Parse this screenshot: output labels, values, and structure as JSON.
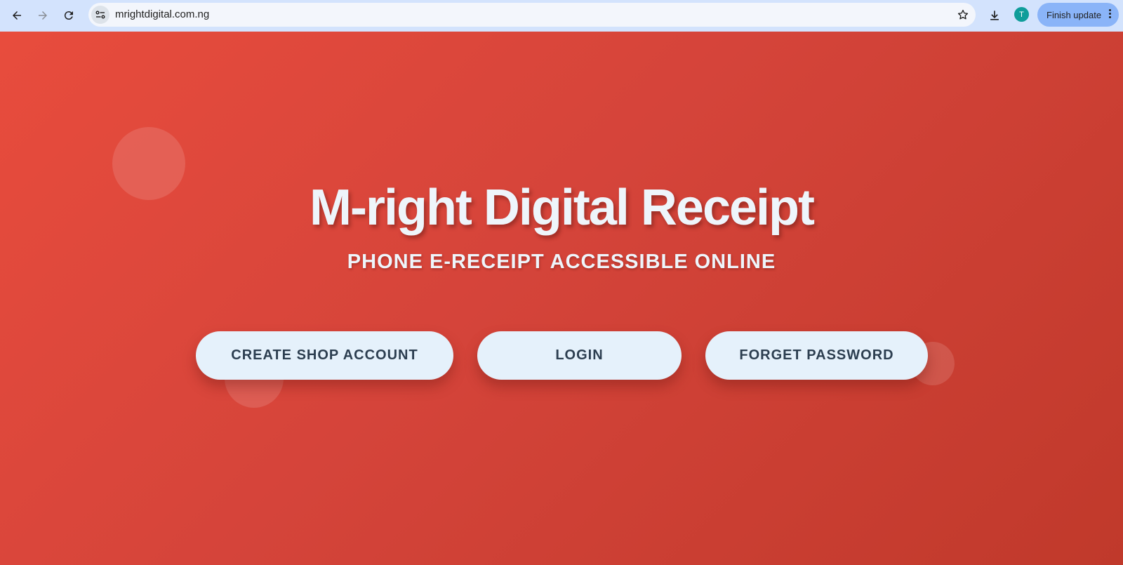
{
  "browser": {
    "url": "mrightdigital.com.ng",
    "avatar_initial": "T",
    "finish_update_label": "Finish update"
  },
  "hero": {
    "title": "M-right Digital Receipt",
    "subtitle": "PHONE E-RECEIPT ACCESSIBLE ONLINE",
    "buttons": [
      {
        "label": "CREATE SHOP ACCOUNT"
      },
      {
        "label": "LOGIN"
      },
      {
        "label": "FORGET PASSWORD"
      }
    ]
  },
  "colors": {
    "accent_red": "#e84c3d",
    "button_bg": "#e5f1fb",
    "button_text": "#2c3e50",
    "toolbar_bg": "#d3e3fd",
    "update_pill": "#8ab4f8"
  },
  "icons": [
    "back-arrow-icon",
    "forward-arrow-icon",
    "reload-icon",
    "site-info-icon",
    "star-icon",
    "download-icon",
    "more-vert-icon"
  ]
}
